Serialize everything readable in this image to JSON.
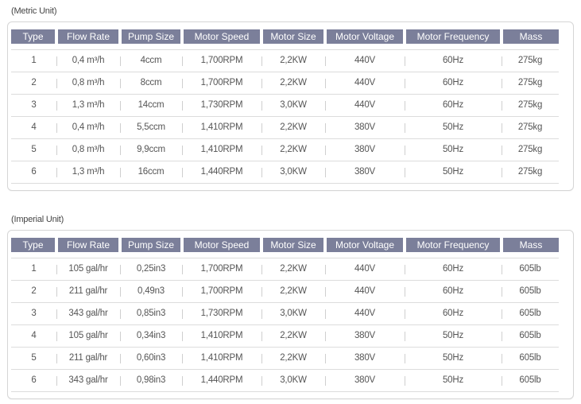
{
  "metric": {
    "caption": "(Metric Unit)",
    "headers": [
      "Type",
      "Flow Rate",
      "Pump Size",
      "Motor Speed",
      "Motor Size",
      "Motor Voltage",
      "Motor Frequency",
      "Mass"
    ],
    "rows": [
      [
        "1",
        "0,4 m³/h",
        "4ccm",
        "1,700RPM",
        "2,2KW",
        "440V",
        "60Hz",
        "275kg"
      ],
      [
        "2",
        "0,8 m³/h",
        "8ccm",
        "1,700RPM",
        "2,2KW",
        "440V",
        "60Hz",
        "275kg"
      ],
      [
        "3",
        "1,3 m³/h",
        "14ccm",
        "1,730RPM",
        "3,0KW",
        "440V",
        "60Hz",
        "275kg"
      ],
      [
        "4",
        "0,4 m³/h",
        "5,5ccm",
        "1,410RPM",
        "2,2KW",
        "380V",
        "50Hz",
        "275kg"
      ],
      [
        "5",
        "0,8 m³/h",
        "9,9ccm",
        "1,410RPM",
        "2,2KW",
        "380V",
        "50Hz",
        "275kg"
      ],
      [
        "6",
        "1,3 m³/h",
        "16ccm",
        "1,440RPM",
        "3,0KW",
        "380V",
        "50Hz",
        "275kg"
      ]
    ]
  },
  "imperial": {
    "caption": "(Imperial Unit)",
    "headers": [
      "Type",
      "Flow Rate",
      "Pump Size",
      "Motor Speed",
      "Motor Size",
      "Motor Voltage",
      "Motor Frequency",
      "Mass"
    ],
    "rows": [
      [
        "1",
        "105 gal/hr",
        "0,25in3",
        "1,700RPM",
        "2,2KW",
        "440V",
        "60Hz",
        "605lb"
      ],
      [
        "2",
        "211 gal/hr",
        "0,49n3",
        "1,700RPM",
        "2,2KW",
        "440V",
        "60Hz",
        "605lb"
      ],
      [
        "3",
        "343 gal/hr",
        "0,85in3",
        "1,730RPM",
        "3,0KW",
        "440V",
        "60Hz",
        "605lb"
      ],
      [
        "4",
        "105 gal/hr",
        "0,34in3",
        "1,410RPM",
        "2,2KW",
        "380V",
        "50Hz",
        "605lb"
      ],
      [
        "5",
        "211 gal/hr",
        "0,60in3",
        "1,410RPM",
        "2,2KW",
        "380V",
        "50Hz",
        "605lb"
      ],
      [
        "6",
        "343 gal/hr",
        "0,98in3",
        "1,440RPM",
        "3,0KW",
        "380V",
        "50Hz",
        "605lb"
      ]
    ]
  },
  "colors": {
    "header_bg": "#7b7f9a",
    "header_text": "#ffffff",
    "cell_text": "#555555",
    "panel_border": "#d6d6d6"
  }
}
